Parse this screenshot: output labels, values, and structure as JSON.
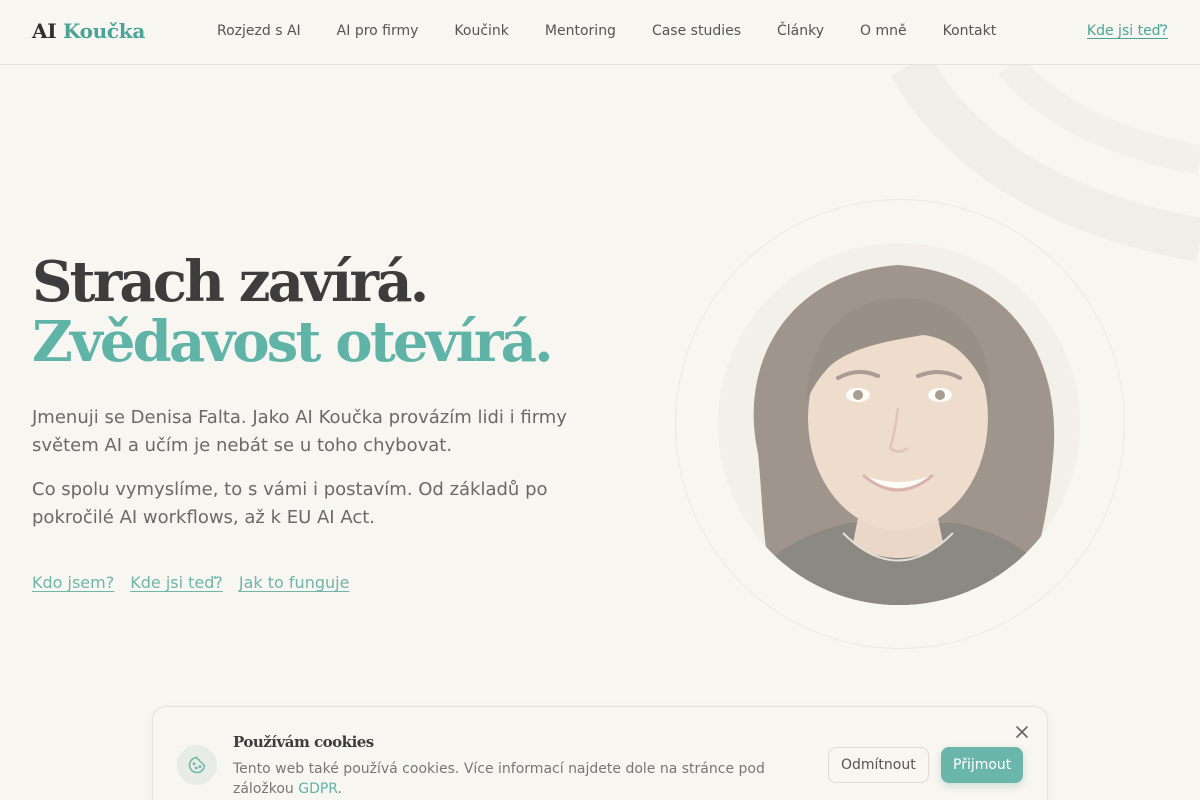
{
  "header": {
    "logo_prefix": "AI",
    "logo_accent": "Koučka",
    "nav": [
      {
        "label": "Rozjezd s AI"
      },
      {
        "label": "AI pro firmy"
      },
      {
        "label": "Koučink"
      },
      {
        "label": "Mentoring"
      },
      {
        "label": "Case studies"
      },
      {
        "label": "Články"
      },
      {
        "label": "O mně"
      },
      {
        "label": "Kontakt"
      }
    ],
    "cta_label": "Kde jsi teď?"
  },
  "hero": {
    "title_line1": "Strach zavírá.",
    "title_line2": "Zvědavost otevírá.",
    "paragraph1": "Jmenuji se Denisa Falta. Jako AI Koučka provázím lidi i firmy světem AI a učím je nebát se u toho chybovat.",
    "paragraph2": "Co spolu vymyslíme, to s vámi i postavím. Od základů po pokročilé AI workflows, až k EU AI Act.",
    "links": [
      {
        "label": "Kdo jsem?"
      },
      {
        "label": "Kde jsi teď?"
      },
      {
        "label": "Jak to funguje"
      }
    ]
  },
  "cookie": {
    "title": "Používám cookies",
    "text_before": "Tento web také používá cookies. Více informací najdete dole na stránce pod záložkou ",
    "link_label": "GDPR",
    "text_after": ".",
    "decline_label": "Odmítnout",
    "accept_label": "Přijmout"
  },
  "colors": {
    "background": "#f8f6f0",
    "accent": "#5fb3a7",
    "heading": "#3d3d3d",
    "body_text": "#6a6a6a"
  },
  "icons": {
    "cookie": "cookie-icon",
    "close": "close-icon"
  }
}
